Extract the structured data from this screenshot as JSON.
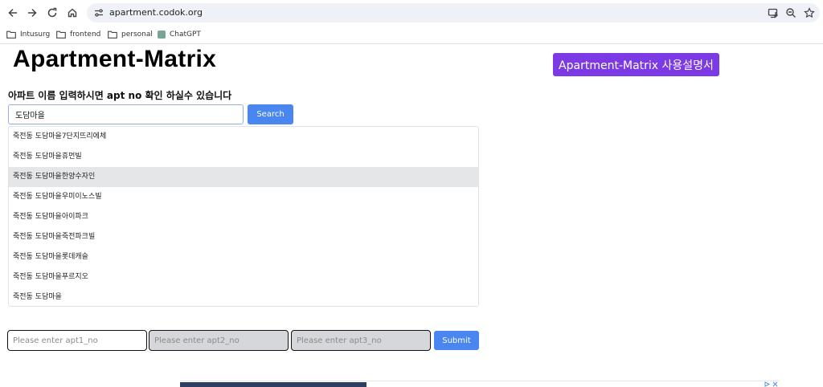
{
  "browser": {
    "url": "apartment.codok.org",
    "bookmarks": [
      {
        "label": "Intusurg",
        "icon": "folder-icon"
      },
      {
        "label": "frontend",
        "icon": "folder-icon"
      },
      {
        "label": "personal",
        "icon": "folder-icon"
      },
      {
        "label": "ChatGPT",
        "icon": "chatgpt-icon"
      }
    ]
  },
  "page": {
    "title": "Apartment-Matrix",
    "manual_button": "Apartment-Matrix 사용설명서",
    "instruction": "아파트 이름 입력하시면 apt no 확인 하실수 있습니다",
    "search": {
      "value": "도담마을",
      "button": "Search"
    },
    "suggestions": [
      "죽전동 도담마을7단지뜨리에체",
      "죽전동 도담마을휴먼빌",
      "죽전동 도담마을한양수자인",
      "죽전동 도담마을우미이노스빌",
      "죽전동 도담마을아이파크",
      "죽전동 도담마을죽전파크빌",
      "죽전동 도담마을롯데캐슬",
      "죽전동 도담마을푸르지오",
      "죽전동 도담마을"
    ],
    "highlighted_index": 2,
    "apt_inputs": [
      {
        "placeholder": "Please enter apt1_no"
      },
      {
        "placeholder": "Please enter apt2_no"
      },
      {
        "placeholder": "Please enter apt3_no"
      }
    ],
    "submit": "Submit"
  },
  "colors": {
    "accent_blue": "#4a86f0",
    "manual_purple": "#7b3ae3",
    "highlight": "#e5e6e8"
  }
}
